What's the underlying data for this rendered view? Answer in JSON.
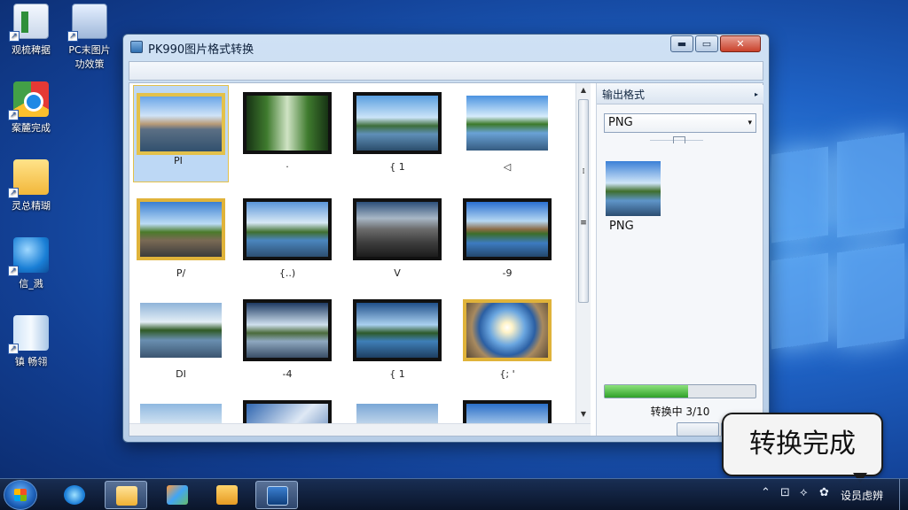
{
  "desktop": {
    "icons": [
      {
        "label": "观梳稗据"
      },
      {
        "label": "PC末图片\n功效策"
      },
      {
        "label": "案麓完成"
      },
      {
        "label": "灵总精瑚"
      },
      {
        "label": "信_溅"
      },
      {
        "label": "镇  畅翎"
      }
    ]
  },
  "window": {
    "title": "PK990图片格式转换",
    "min_label": "▬",
    "max_label": "▭",
    "close_label": "✕"
  },
  "thumbnails": [
    {
      "caption": "PI"
    },
    {
      "caption": "·"
    },
    {
      "caption": "{ 1"
    },
    {
      "caption": "◁"
    },
    {
      "caption": "P/"
    },
    {
      "caption": "{..)"
    },
    {
      "caption": "V"
    },
    {
      "caption": "-9"
    },
    {
      "caption": "DI"
    },
    {
      "caption": "-4"
    },
    {
      "caption": "{ 1"
    },
    {
      "caption": "{; '"
    },
    {
      "caption": ""
    },
    {
      "caption": ""
    },
    {
      "caption": ""
    },
    {
      "caption": ""
    }
  ],
  "scrollbar": {
    "up": "▲",
    "down": "▼",
    "grip1": "⁞",
    "grip2": "≡"
  },
  "side_panel": {
    "header": "输出格式",
    "header_chevron": "▸",
    "format_selected": "PNG",
    "dropdown_arrow": "▾",
    "preview_label": "PNG",
    "progress_fraction": 0.55,
    "progress_label": "转换中 3/10"
  },
  "bubble": {
    "text": "转换完成"
  },
  "taskbar": {
    "tray_up": "⌃",
    "tray_icons": [
      "⊡",
      "⟡",
      "✿"
    ],
    "tray_text": "设员虑辨"
  }
}
